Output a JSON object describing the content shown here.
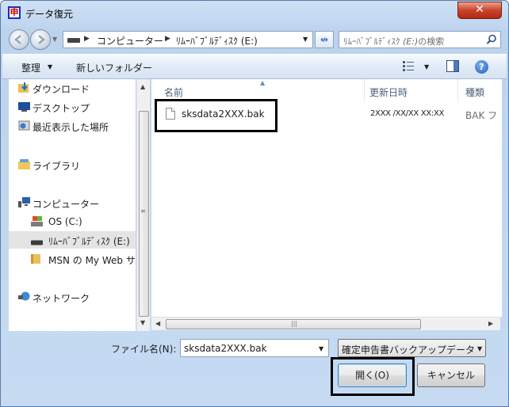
{
  "window": {
    "app_icon_glyph": "申",
    "title": "データ復元",
    "close_glyph": "✕"
  },
  "address": {
    "segments": [
      "コンピューター",
      "ﾘﾑｰﾊﾞﾌﾞﾙﾃﾞｨｽｸ (E:)"
    ],
    "search_placeholder_prefix": "ﾘﾑｰﾊﾞﾌﾞﾙﾃﾞｨｽｸ ",
    "search_placeholder_em": "(E:)",
    "search_placeholder_suffix": "の検索",
    "refresh_glyph": "↮"
  },
  "toolbar": {
    "organize_label": "整理",
    "new_folder_label": "新しいフォルダー",
    "help_glyph": "?"
  },
  "navpane": {
    "items": [
      {
        "label": "ダウンロード",
        "icon": "downloads-folder-icon"
      },
      {
        "label": "デスクトップ",
        "icon": "desktop-icon"
      },
      {
        "label": "最近表示した場所",
        "icon": "recent-places-icon"
      },
      {
        "label": "ライブラリ",
        "icon": "libraries-icon"
      },
      {
        "label": "コンピューター",
        "icon": "computer-icon"
      },
      {
        "label": "OS (C:)",
        "icon": "os-drive-icon"
      },
      {
        "label": "ﾘﾑｰﾊﾞﾌﾞﾙﾃﾞｨｽｸ (E:)",
        "icon": "removable-drive-icon"
      },
      {
        "label": "MSN の My Web サ",
        "icon": "folder-icon"
      },
      {
        "label": "ネットワーク",
        "icon": "network-icon"
      }
    ],
    "selected_index": 6
  },
  "filelist": {
    "columns": [
      "名前",
      "更新日時",
      "種類"
    ],
    "rows": [
      {
        "name": "sksdata2XXX.bak",
        "date": "2XXX /XX/XX  XX:XX",
        "type": "BAK フ"
      }
    ]
  },
  "bottom": {
    "filename_label": "ファイル名(N):",
    "filename_value": "sksdata2XXX.bak",
    "filetype_value": "確定申告書バックアップデータ",
    "open_label": "開く(O)",
    "cancel_label": "キャンセル"
  }
}
